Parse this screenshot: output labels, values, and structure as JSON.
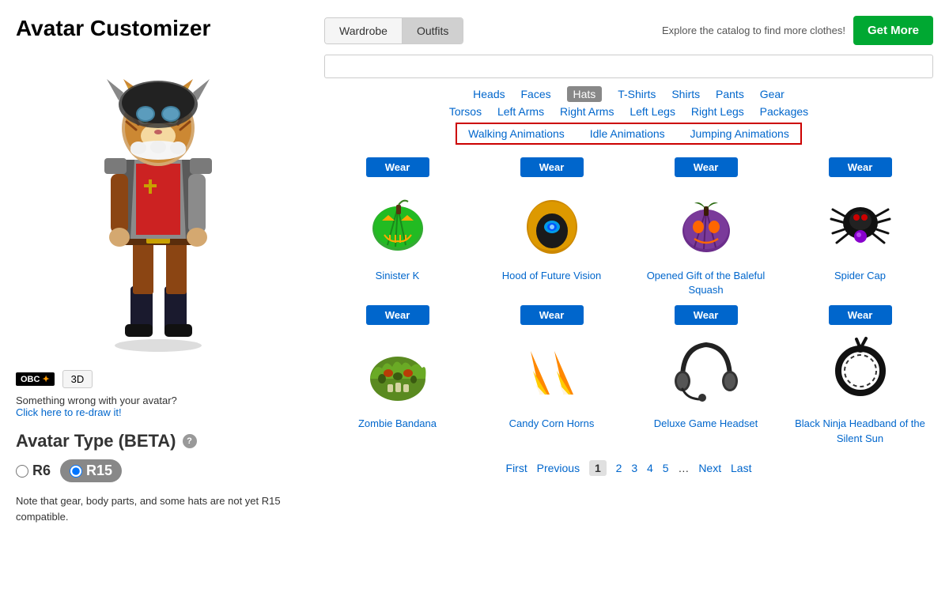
{
  "page": {
    "title": "Avatar Customizer"
  },
  "left": {
    "obc_label": "OBC",
    "btn_3d": "3D",
    "wrong_text": "Something wrong with your avatar?",
    "redraw_text": "Click here to re-draw it!",
    "avatar_type_title": "Avatar Type (BETA)",
    "radio_r6": "R6",
    "radio_r15": "R15",
    "note": "Note that gear, body parts, and some hats are not yet R15 compatible."
  },
  "right": {
    "tab_wardrobe": "Wardrobe",
    "tab_outfits": "Outfits",
    "catalog_text": "Explore the catalog to find more clothes!",
    "get_more_label": "Get More",
    "search_placeholder": "",
    "categories_row1": [
      {
        "label": "Heads",
        "active": false
      },
      {
        "label": "Faces",
        "active": false
      },
      {
        "label": "Hats",
        "active": true
      },
      {
        "label": "T-Shirts",
        "active": false
      },
      {
        "label": "Shirts",
        "active": false
      },
      {
        "label": "Pants",
        "active": false
      },
      {
        "label": "Gear",
        "active": false
      }
    ],
    "categories_row2": [
      {
        "label": "Torsos",
        "active": false
      },
      {
        "label": "Left Arms",
        "active": false
      },
      {
        "label": "Right Arms",
        "active": false
      },
      {
        "label": "Left Legs",
        "active": false
      },
      {
        "label": "Right Legs",
        "active": false
      },
      {
        "label": "Packages",
        "active": false
      }
    ],
    "animations": [
      {
        "label": "Walking Animations"
      },
      {
        "label": "Idle Animations"
      },
      {
        "label": "Jumping Animations"
      }
    ],
    "items": [
      {
        "name": "Sinister K",
        "wear_label": "Wear"
      },
      {
        "name": "Hood of Future Vision",
        "wear_label": "Wear"
      },
      {
        "name": "Opened Gift of the Baleful Squash",
        "wear_label": "Wear"
      },
      {
        "name": "Spider Cap",
        "wear_label": "Wear"
      },
      {
        "name": "Zombie Bandana",
        "wear_label": "Wear"
      },
      {
        "name": "Candy Corn Horns",
        "wear_label": "Wear"
      },
      {
        "name": "Deluxe Game Headset",
        "wear_label": "Wear"
      },
      {
        "name": "Black Ninja Headband of the Silent Sun",
        "wear_label": "Wear"
      }
    ],
    "pagination": {
      "first": "First",
      "previous": "Previous",
      "pages": [
        "1",
        "2",
        "3",
        "4",
        "5"
      ],
      "dots": "…",
      "next": "Next",
      "last": "Last",
      "current": "1"
    }
  }
}
